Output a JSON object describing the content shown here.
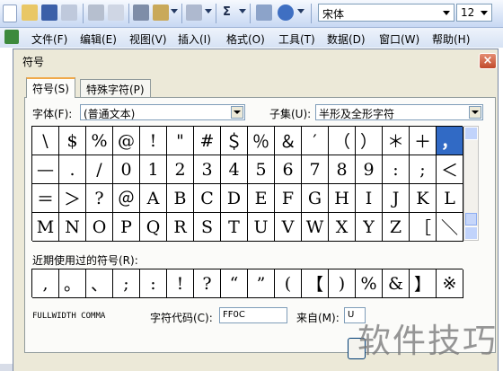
{
  "toolbar": {
    "sigma": "Σ",
    "font_name": "宋体",
    "font_size": "12"
  },
  "menu": [
    "文件(F)",
    "编辑(E)",
    "视图(V)",
    "插入(I)",
    "格式(O)",
    "工具(T)",
    "数据(D)",
    "窗口(W)",
    "帮助(H)"
  ],
  "dialog": {
    "title": "符号",
    "close": "×",
    "tabs": [
      "符号(S)",
      "特殊字符(P)"
    ],
    "font_label": "字体(F):",
    "font_value": "(普通文本)",
    "subset_label": "子集(U):",
    "subset_value": "半形及全形字符",
    "grid": [
      [
        "\\",
        "$",
        "%",
        "@",
        "!",
        "\"",
        "#",
        "＄",
        "％",
        "＆",
        "′",
        "（",
        "）",
        "＊",
        "＋",
        "，"
      ],
      [
        "—",
        ".",
        "/",
        "0",
        "1",
        "2",
        "3",
        "4",
        "5",
        "6",
        "7",
        "8",
        "9",
        ":",
        ";",
        "＜"
      ],
      [
        "＝",
        "＞",
        "?",
        "＠",
        "A",
        "B",
        "C",
        "D",
        "E",
        "F",
        "G",
        "H",
        "I",
        "J",
        "K",
        "L"
      ],
      [
        "M",
        "N",
        "O",
        "P",
        "Q",
        "R",
        "S",
        "T",
        "U",
        "V",
        "W",
        "X",
        "Y",
        "Z",
        "［",
        "＼"
      ]
    ],
    "selected_char": "，",
    "recent_label": "近期使用过的符号(R):",
    "recent": [
      ",",
      "。",
      "、",
      ";",
      ":",
      "!",
      "?",
      "“",
      "”",
      "(",
      "【",
      ")",
      "%",
      "&",
      "】",
      "※"
    ],
    "char_name": "FULLWIDTH COMMA",
    "code_label": "字符代码(C):",
    "code_value": "FF0C",
    "from_label": "来自(M):",
    "from_value": "U"
  },
  "watermark": "软件技巧"
}
